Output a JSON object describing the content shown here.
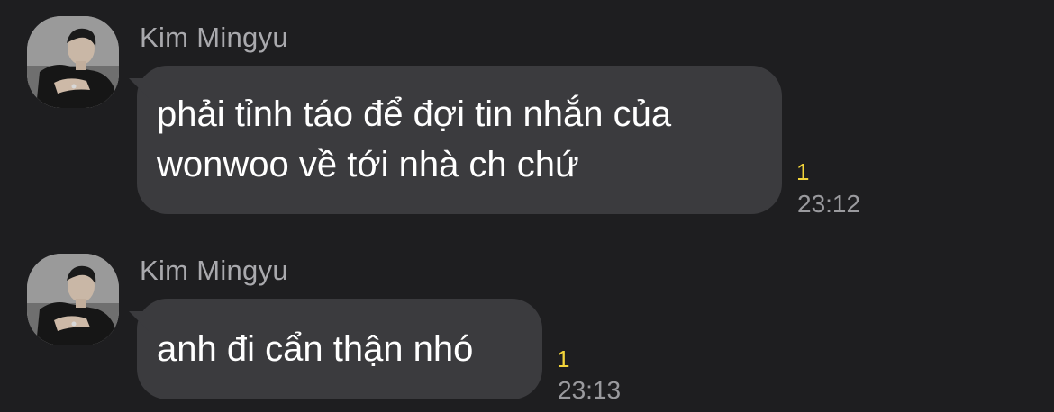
{
  "messages": [
    {
      "sender": "Kim Mingyu",
      "avatar_icon": "person-photo-avatar",
      "text": "phải tỉnh táo để đợi tin nhắn của\nwonwoo về tới nhà ch chứ",
      "unread_count": "1",
      "time": "23:12"
    },
    {
      "sender": "Kim Mingyu",
      "avatar_icon": "person-photo-avatar",
      "text": "anh đi cẩn thận nhó",
      "unread_count": "1",
      "time": "23:13"
    }
  ],
  "colors": {
    "background": "#1e1e20",
    "bubble": "#3b3b3e",
    "sender_text": "#a9a9ad",
    "message_text": "#ffffff",
    "unread_badge": "#f2d43a",
    "timestamp": "#9a9a9e"
  }
}
